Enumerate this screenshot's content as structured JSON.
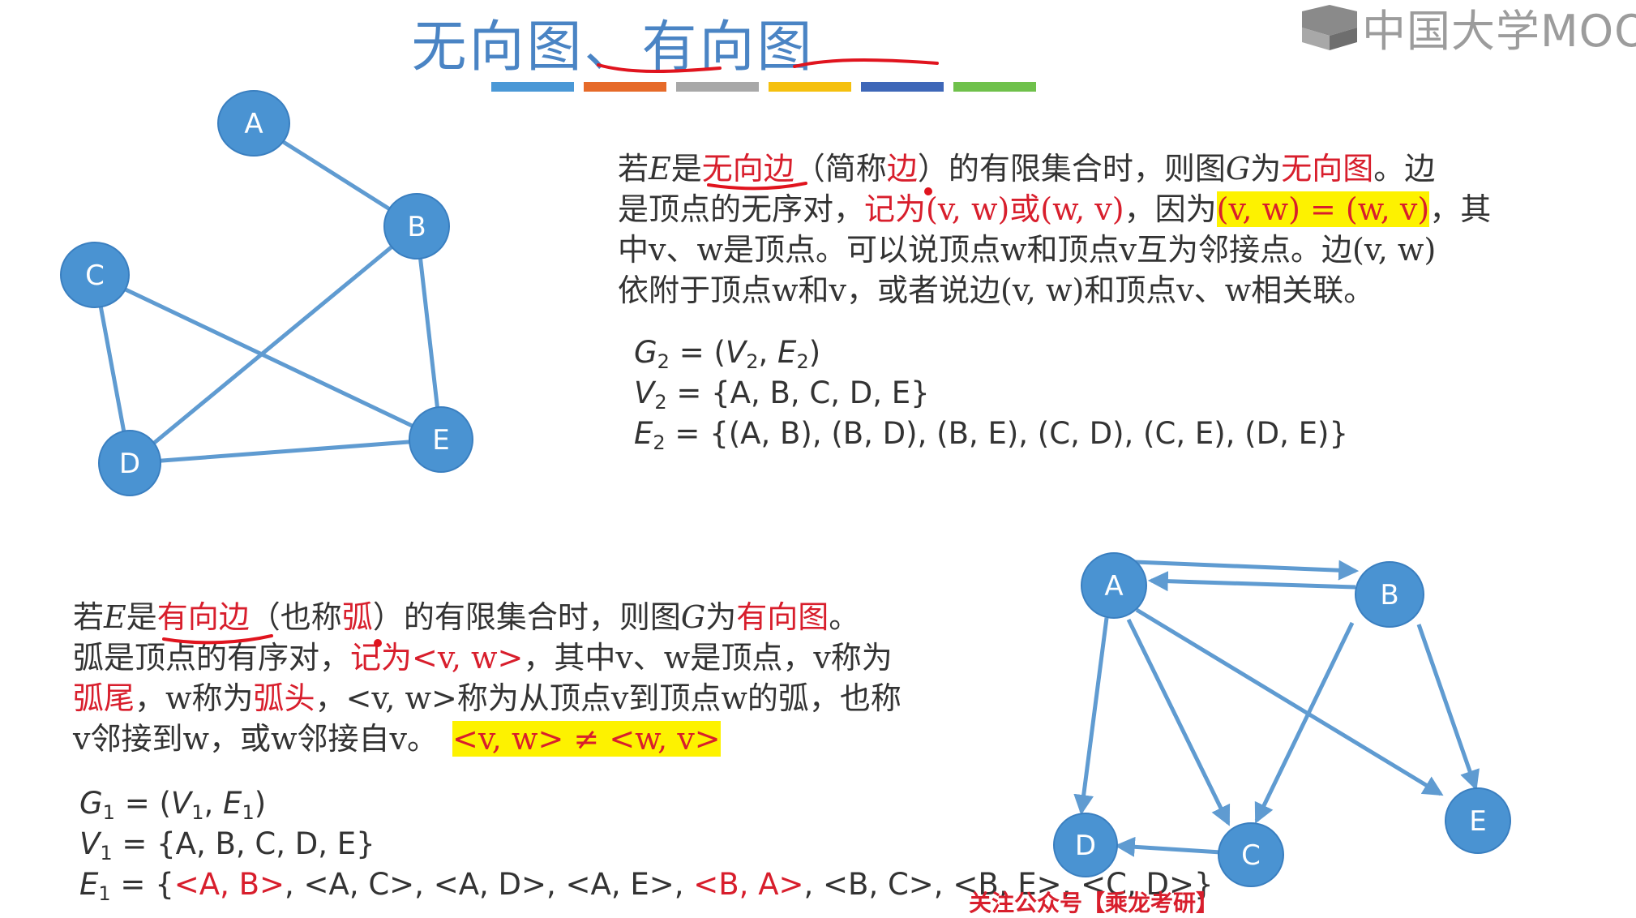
{
  "title": {
    "part1": "无向图",
    "separator": "、",
    "part2": "有向图"
  },
  "brand": {
    "logo_text": "中国大学MOOC"
  },
  "color_bar": [
    "#4a98d6",
    "#e66a29",
    "#a8a8a8",
    "#f5c00e",
    "#3e67b8",
    "#6fc14b"
  ],
  "undirected": {
    "vertices": [
      "A",
      "B",
      "C",
      "D",
      "E"
    ],
    "edges": [
      [
        "A",
        "B"
      ],
      [
        "B",
        "D"
      ],
      [
        "B",
        "E"
      ],
      [
        "C",
        "D"
      ],
      [
        "C",
        "E"
      ],
      [
        "D",
        "E"
      ]
    ],
    "para": {
      "l1a": "若",
      "l1b": "E",
      "l1c": "是",
      "l1d": "无向边",
      "l1e": "（简称",
      "l1f": "边",
      "l1g": "）的有限集合时，则图",
      "l1h": "G",
      "l1i": "为",
      "l1j": "无向图",
      "l1k": "。边",
      "l2a": "是顶点的无序对，",
      "l2b": "记为(v, w)或(w, v)",
      "l2c": "，因为",
      "l2d": "(v, w) = (w, v)",
      "l2e": "，其",
      "l3": "中v、w是顶点。可以说顶点w和顶点v互为邻接点。边(v, w)",
      "l4": "依附于顶点w和v，或者说边(v, w)和顶点v、w相关联。"
    },
    "formula": {
      "g_name": "G",
      "g_sub": "2",
      "g_eq": " = (",
      "g_v": "V",
      "g_v_sub": "2",
      "g_comma": ", ",
      "g_e": "E",
      "g_e_sub": "2",
      "g_close": ")",
      "v_name": "V",
      "v_sub": "2",
      "v_rest": " = {A, B, C, D, E}",
      "e_name": "E",
      "e_sub": "2",
      "e_rest": " = {(A, B), (B, D), (B, E), (C, D), (C, E), (D, E)}"
    }
  },
  "directed": {
    "vertices": [
      "A",
      "B",
      "C",
      "D",
      "E"
    ],
    "arcs": [
      [
        "A",
        "B"
      ],
      [
        "B",
        "A"
      ],
      [
        "A",
        "C"
      ],
      [
        "A",
        "D"
      ],
      [
        "A",
        "E"
      ],
      [
        "B",
        "C"
      ],
      [
        "B",
        "E"
      ],
      [
        "C",
        "D"
      ]
    ],
    "para": {
      "l1a": "若",
      "l1b": "E",
      "l1c": "是",
      "l1d": "有向边",
      "l1e": "（也称",
      "l1f": "弧",
      "l1g": "）的有限集合时，则图",
      "l1h": "G",
      "l1i": "为",
      "l1j": "有向图",
      "l1k": "。",
      "l2a": "弧是顶点的有序对，",
      "l2b": "记为<v, w>",
      "l2c": "，其中v、w是顶点，v称为",
      "l3a": "弧尾",
      "l3b": "，w称为",
      "l3c": "弧头",
      "l3d": "，<v, w>称为从顶点v到顶点w的弧，也称",
      "l4a": "v邻接到w，或w邻接自v。",
      "l4b": "<v, w> ≠ <w, v>"
    },
    "formula": {
      "g_name": "G",
      "g_sub": "1",
      "g_eq": " = (",
      "g_v": "V",
      "g_v_sub": "1",
      "g_comma": ", ",
      "g_e": "E",
      "g_e_sub": "1",
      "g_close": ")",
      "v_name": "V",
      "v_sub": "1",
      "v_rest": " = {A, B, C, D, E}",
      "e_name": "E",
      "e_sub": "1",
      "e_open": " = {",
      "e_arc1": "<A, B>",
      "e_mid1": ", <A, C>, <A, D>, <A, E>, ",
      "e_arc2": "<B, A>",
      "e_mid2": ", <B, C>, <B, E>, <C, D>}"
    }
  },
  "watermark": "关注公众号【乘龙考研】",
  "colors": {
    "title": "#4a84c4",
    "node_fill": "#4a93d2",
    "edge": "#5f9bd1",
    "emphasis_red": "#d81e2c",
    "highlight_yellow": "#fdf200",
    "annotation_ink": "#e0141e"
  }
}
